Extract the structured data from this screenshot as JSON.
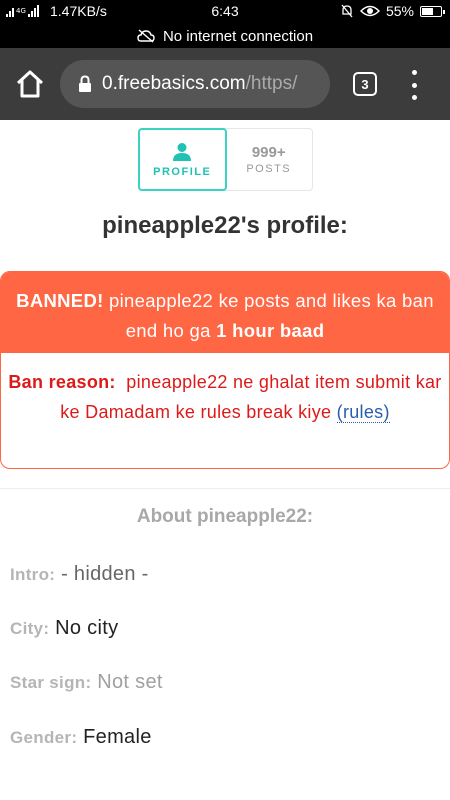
{
  "status_bar": {
    "network_speed": "1.47KB/s",
    "time": "6:43",
    "battery": "55%",
    "battery_level": 0.55
  },
  "connection_banner": {
    "text": "No internet connection"
  },
  "browser": {
    "url_host": "0.freebasics.com",
    "url_path": "/https/",
    "tab_count": "3"
  },
  "profile_tabs": [
    {
      "label": "PROFILE",
      "icon": "user-icon"
    },
    {
      "count": "999+",
      "label": "POSTS"
    }
  ],
  "page_title": "pineapple22's profile:",
  "ban": {
    "head_bold": "BANNED!",
    "head_text": " pineapple22 ke posts and likes ka ban end ho ga ",
    "head_duration": "1 hour baad",
    "reason_label": "Ban reason:",
    "reason_text": "  pineapple22 ne ghalat item submit kar ke Damadam ke rules break kiye ",
    "rules_link": "(rules)"
  },
  "about": {
    "title": "About pineapple22:",
    "fields": [
      {
        "label": "Intro:",
        "value": "- hidden -"
      },
      {
        "label": "City:",
        "value": "No city"
      },
      {
        "label": "Star sign:",
        "value": "Not set"
      },
      {
        "label": "Gender:",
        "value": "Female"
      }
    ]
  }
}
